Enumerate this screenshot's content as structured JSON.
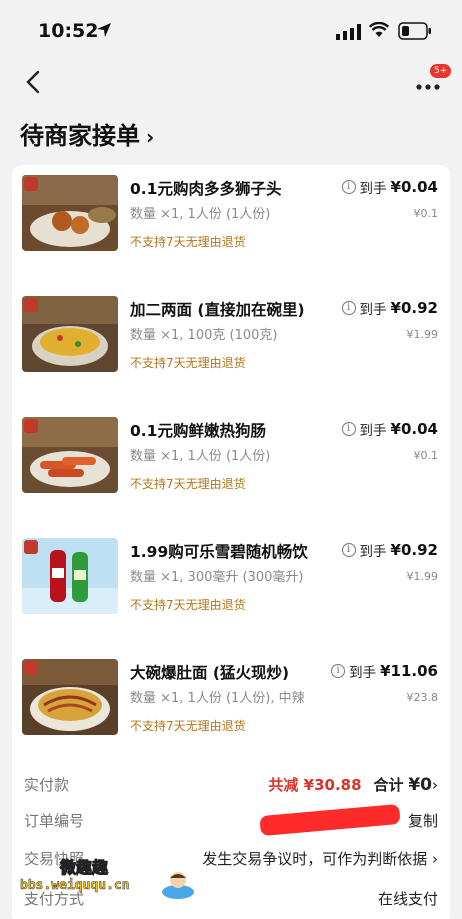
{
  "status_bar": {
    "time": "10:52"
  },
  "nav": {
    "badge": "5+"
  },
  "order_status": {
    "title": "待商家接单",
    "chevron": "›"
  },
  "items": [
    {
      "title": "0.1元购肉多多狮子头",
      "spec": "数量 ×1, 1人份 (1人份)",
      "return_policy": "不支持7天无理由退货",
      "price_label": "到手",
      "price": "¥0.04",
      "original_price": "¥0.1"
    },
    {
      "title": "加二两面 (直接加在碗里)",
      "spec": "数量 ×1, 100克 (100克)",
      "return_policy": "不支持7天无理由退货",
      "price_label": "到手",
      "price": "¥0.92",
      "original_price": "¥1.99"
    },
    {
      "title": "0.1元购鲜嫩热狗肠",
      "spec": "数量 ×1, 1人份 (1人份)",
      "return_policy": "不支持7天无理由退货",
      "price_label": "到手",
      "price": "¥0.04",
      "original_price": "¥0.1"
    },
    {
      "title": "1.99购可乐雪碧随机畅饮",
      "spec": "数量 ×1, 300毫升 (300毫升)",
      "return_policy": "不支持7天无理由退货",
      "price_label": "到手",
      "price": "¥0.92",
      "original_price": "¥1.99"
    },
    {
      "title": "大碗爆肚面 (猛火现炒)",
      "spec": "数量 ×1, 1人份 (1人份), 中辣",
      "return_policy": "不支持7天无理由退货",
      "price_label": "到手",
      "price": "¥11.06",
      "original_price": "¥23.8"
    }
  ],
  "summary": {
    "paid_label": "实付款",
    "discount": "共减 ¥30.88",
    "total_label": "合计",
    "total_value": "¥0",
    "chevron": "›",
    "order_no_label": "订单编号",
    "copy_label": "复制",
    "snapshot_label": "交易快照",
    "snapshot_hint": "发生交易争议时，可作为判断依据",
    "payment_label": "支付方式",
    "payment_value": "在线支付"
  },
  "watermark": {
    "title": "微趣趣",
    "url": "bbs.weiququ.cn"
  },
  "colors": {
    "discount_red": "#d7342a",
    "return_orange": "#b5761c",
    "badge_red": "#e8352b"
  }
}
